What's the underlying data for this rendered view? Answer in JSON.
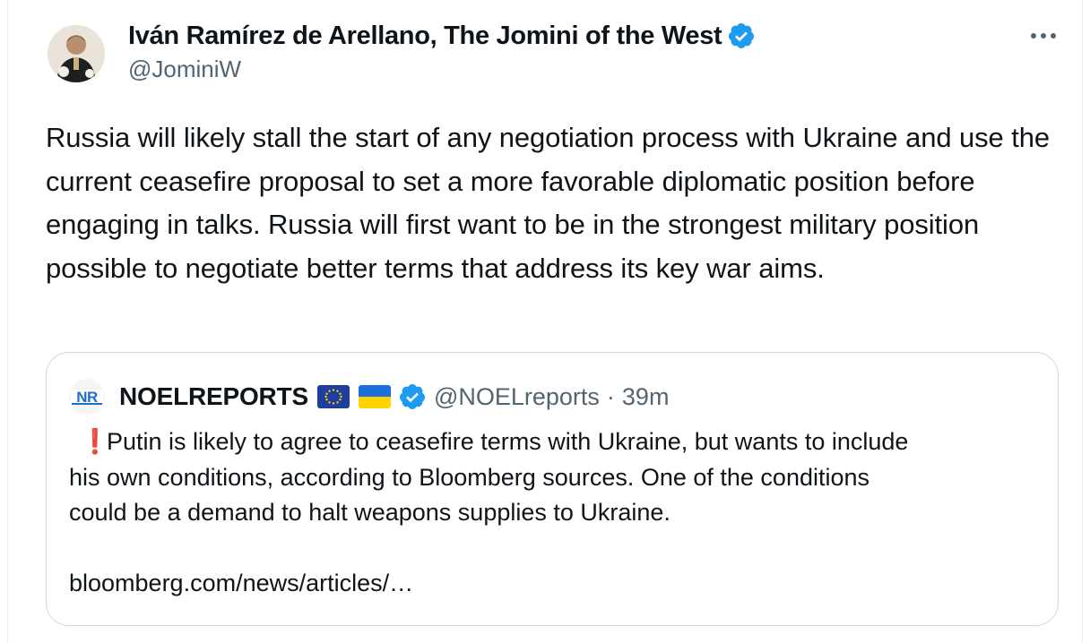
{
  "tweet": {
    "author": {
      "display_name": "Iván Ramírez de Arellano, The Jomini of the West",
      "handle": "@JominiW",
      "verified_icon": "verified-badge-icon",
      "avatar_icon": "profile-photo"
    },
    "more_icon": "more-options-icon",
    "text": "Russia will likely stall the start of any negotiation process with Ukraine and use the current ceasefire proposal to set a more favorable diplomatic position before engaging in talks. Russia will first want to be in the strongest military position possible to negotiate better terms that address its key war aims."
  },
  "quote": {
    "logo_text": "NR",
    "name": "NOELREPORTS",
    "flags": [
      "eu-flag-icon",
      "ukraine-flag-icon"
    ],
    "handle": "@NOELreports",
    "separator": "·",
    "time": "39m",
    "text_lines": [
      "Putin is likely to agree to ceasefire terms with Ukraine, but wants to include",
      "his own conditions, according to Bloomberg sources. One of the conditions",
      "could be a demand to halt weapons supplies to Ukraine."
    ],
    "exclamation": "❗",
    "link": "bloomberg.com/news/articles/…"
  },
  "colors": {
    "verified_blue": "#1d9bf0",
    "text": "#0f1419",
    "secondary": "#536471",
    "border": "#cfd9de"
  }
}
